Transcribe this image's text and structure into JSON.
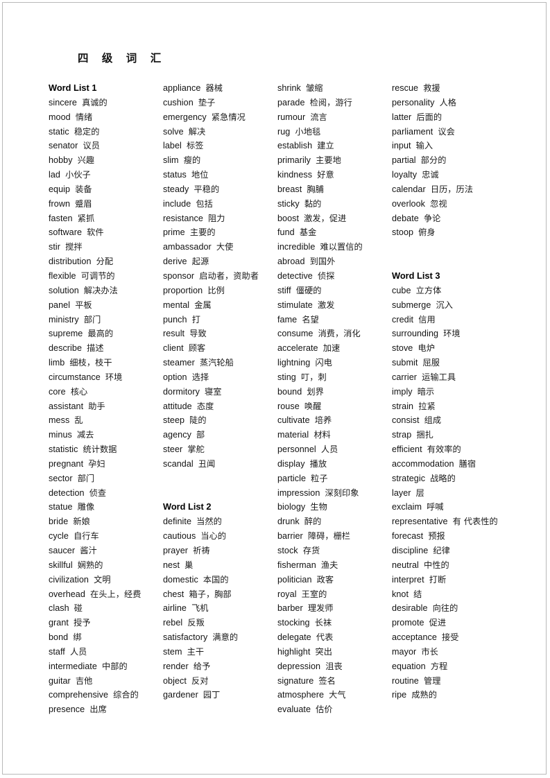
{
  "document": {
    "title": "四 级 词 汇",
    "page_border_color": "#b9b9b9"
  },
  "columns": [
    {
      "name": "column-1",
      "blocks": [
        {
          "type": "heading",
          "text": "Word List 1"
        },
        {
          "type": "entry",
          "term": "sincere",
          "gloss": "真诚的"
        },
        {
          "type": "entry",
          "term": "mood",
          "gloss": "情绪"
        },
        {
          "type": "entry",
          "term": "static",
          "gloss": "稳定的"
        },
        {
          "type": "entry",
          "term": "senator",
          "gloss": "议员"
        },
        {
          "type": "entry",
          "term": "hobby",
          "gloss": "兴趣"
        },
        {
          "type": "entry",
          "term": "lad",
          "gloss": "小伙子"
        },
        {
          "type": "entry",
          "term": "equip",
          "gloss": "装备"
        },
        {
          "type": "entry",
          "term": "frown",
          "gloss": "蹙眉"
        },
        {
          "type": "entry",
          "term": "fasten",
          "gloss": "紧抓"
        },
        {
          "type": "entry",
          "term": "software",
          "gloss": "软件"
        },
        {
          "type": "entry",
          "term": "stir",
          "gloss": "搅拌"
        },
        {
          "type": "entry",
          "term": "distribution",
          "gloss": "分配"
        },
        {
          "type": "entry",
          "term": "flexible",
          "gloss": "可调节的"
        },
        {
          "type": "entry",
          "term": "solution",
          "gloss": "解决办法"
        },
        {
          "type": "entry",
          "term": "panel",
          "gloss": "平板"
        },
        {
          "type": "entry",
          "term": "ministry",
          "gloss": "部门"
        },
        {
          "type": "entry",
          "term": "supreme",
          "gloss": "最高的"
        },
        {
          "type": "entry",
          "term": "describe",
          "gloss": "描述"
        },
        {
          "type": "entry",
          "term": "limb",
          "gloss": "细枝，枝干"
        },
        {
          "type": "entry",
          "term": "circumstance",
          "gloss": "环境"
        },
        {
          "type": "entry",
          "term": "core",
          "gloss": "核心"
        },
        {
          "type": "entry",
          "term": "assistant",
          "gloss": "助手"
        },
        {
          "type": "entry",
          "term": "mess",
          "gloss": "乱"
        },
        {
          "type": "entry",
          "term": "minus",
          "gloss": "减去"
        },
        {
          "type": "entry",
          "term": "statistic",
          "gloss": "统计数据"
        },
        {
          "type": "entry",
          "term": "pregnant",
          "gloss": "孕妇"
        },
        {
          "type": "entry",
          "term": "sector",
          "gloss": "部门"
        },
        {
          "type": "entry",
          "term": "detection",
          "gloss": "侦查"
        },
        {
          "type": "entry",
          "term": "statue",
          "gloss": "雕像"
        },
        {
          "type": "entry",
          "term": "bride",
          "gloss": "新娘"
        },
        {
          "type": "entry",
          "term": "cycle",
          "gloss": "自行车"
        },
        {
          "type": "entry",
          "term": "saucer",
          "gloss": "酱汁"
        },
        {
          "type": "entry",
          "term": "skillful",
          "gloss": "娴熟的"
        },
        {
          "type": "entry",
          "term": "civilization",
          "gloss": "文明"
        },
        {
          "type": "entry",
          "term": "overhead",
          "gloss": "在头上，经费"
        },
        {
          "type": "entry",
          "term": "clash",
          "gloss": "碰"
        },
        {
          "type": "entry",
          "term": "grant",
          "gloss": "授予"
        },
        {
          "type": "entry",
          "term": "bond",
          "gloss": "绑"
        },
        {
          "type": "entry",
          "term": "staff",
          "gloss": "人员"
        },
        {
          "type": "entry",
          "term": "intermediate",
          "gloss": "中部的"
        },
        {
          "type": "entry",
          "term": "guitar",
          "gloss": "吉他"
        },
        {
          "type": "entry",
          "term": "comprehensive",
          "gloss": "综合的"
        },
        {
          "type": "entry",
          "term": "presence",
          "gloss": "出席"
        }
      ]
    },
    {
      "name": "column-2",
      "blocks": [
        {
          "type": "entry",
          "term": "appliance",
          "gloss": "器械"
        },
        {
          "type": "entry",
          "term": "cushion",
          "gloss": "垫子"
        },
        {
          "type": "entry",
          "term": "emergency",
          "gloss": "紧急情况"
        },
        {
          "type": "entry",
          "term": "solve",
          "gloss": "解决"
        },
        {
          "type": "entry",
          "term": "label",
          "gloss": "标签"
        },
        {
          "type": "entry",
          "term": "slim",
          "gloss": "瘦的"
        },
        {
          "type": "entry",
          "term": "status",
          "gloss": "地位"
        },
        {
          "type": "entry",
          "term": "steady",
          "gloss": "平稳的"
        },
        {
          "type": "entry",
          "term": "include",
          "gloss": "包括"
        },
        {
          "type": "entry",
          "term": "resistance",
          "gloss": "阻力"
        },
        {
          "type": "entry",
          "term": "prime",
          "gloss": "主要的"
        },
        {
          "type": "entry",
          "term": "ambassador",
          "gloss": "大使"
        },
        {
          "type": "entry",
          "term": "derive",
          "gloss": "起源"
        },
        {
          "type": "entry",
          "term": "sponsor",
          "gloss": "启动者，资助者"
        },
        {
          "type": "entry",
          "term": "proportion",
          "gloss": "比例"
        },
        {
          "type": "entry",
          "term": "mental",
          "gloss": "金属"
        },
        {
          "type": "entry",
          "term": "punch",
          "gloss": "打"
        },
        {
          "type": "entry",
          "term": "result",
          "gloss": "导致"
        },
        {
          "type": "entry",
          "term": "client",
          "gloss": "顾客"
        },
        {
          "type": "entry",
          "term": "steamer",
          "gloss": "蒸汽轮船"
        },
        {
          "type": "entry",
          "term": "option",
          "gloss": "选择"
        },
        {
          "type": "entry",
          "term": "dormitory",
          "gloss": "寝室"
        },
        {
          "type": "entry",
          "term": "attitude",
          "gloss": "态度"
        },
        {
          "type": "entry",
          "term": "steep",
          "gloss": "陡的"
        },
        {
          "type": "entry",
          "term": "agency",
          "gloss": "部"
        },
        {
          "type": "entry",
          "term": "steer",
          "gloss": "掌舵"
        },
        {
          "type": "entry",
          "term": "scandal",
          "gloss": "丑闻"
        },
        {
          "type": "spacer"
        },
        {
          "type": "spacer"
        },
        {
          "type": "heading",
          "text": "Word List 2"
        },
        {
          "type": "entry",
          "term": "definite",
          "gloss": "当然的"
        },
        {
          "type": "entry",
          "term": "cautious",
          "gloss": "当心的"
        },
        {
          "type": "entry",
          "term": "prayer",
          "gloss": "祈祷"
        },
        {
          "type": "entry",
          "term": "nest",
          "gloss": "巢"
        },
        {
          "type": "entry",
          "term": "domestic",
          "gloss": "本国的"
        },
        {
          "type": "entry",
          "term": "chest",
          "gloss": "箱子，胸部"
        },
        {
          "type": "entry",
          "term": "airline",
          "gloss": "飞机"
        },
        {
          "type": "entry",
          "term": "rebel",
          "gloss": "反叛"
        },
        {
          "type": "entry",
          "term": "satisfactory",
          "gloss": "满意的"
        },
        {
          "type": "entry",
          "term": "stem",
          "gloss": "主干"
        },
        {
          "type": "entry",
          "term": "render",
          "gloss": "给予"
        },
        {
          "type": "entry",
          "term": "object",
          "gloss": "反对"
        },
        {
          "type": "entry",
          "term": "gardener",
          "gloss": "园丁"
        }
      ]
    },
    {
      "name": "column-3",
      "blocks": [
        {
          "type": "entry",
          "term": "shrink",
          "gloss": "皱缩"
        },
        {
          "type": "entry",
          "term": "parade",
          "gloss": "检阅，游行"
        },
        {
          "type": "entry",
          "term": "rumour",
          "gloss": "流言"
        },
        {
          "type": "entry",
          "term": "rug",
          "gloss": "小地毯"
        },
        {
          "type": "entry",
          "term": "establish",
          "gloss": "建立"
        },
        {
          "type": "entry",
          "term": "primarily",
          "gloss": "主要地"
        },
        {
          "type": "entry",
          "term": "kindness",
          "gloss": "好意"
        },
        {
          "type": "entry",
          "term": "breast",
          "gloss": "胸脯"
        },
        {
          "type": "entry",
          "term": "sticky",
          "gloss": "黏的"
        },
        {
          "type": "entry",
          "term": "boost",
          "gloss": "激发，促进"
        },
        {
          "type": "entry",
          "term": "fund",
          "gloss": "基金"
        },
        {
          "type": "entry",
          "term": "incredible",
          "gloss": "难以置信的"
        },
        {
          "type": "entry",
          "term": "abroad",
          "gloss": "到国外"
        },
        {
          "type": "entry",
          "term": "detective",
          "gloss": "侦探"
        },
        {
          "type": "entry",
          "term": "stiff",
          "gloss": "僵硬的"
        },
        {
          "type": "entry",
          "term": "stimulate",
          "gloss": "激发"
        },
        {
          "type": "entry",
          "term": "fame",
          "gloss": "名望"
        },
        {
          "type": "entry",
          "term": "consume",
          "gloss": "消费，消化"
        },
        {
          "type": "entry",
          "term": "accelerate",
          "gloss": "加速"
        },
        {
          "type": "entry",
          "term": "lightning",
          "gloss": "闪电"
        },
        {
          "type": "entry",
          "term": "sting",
          "gloss": "叮，刺"
        },
        {
          "type": "entry",
          "term": "bound",
          "gloss": "划界"
        },
        {
          "type": "entry",
          "term": "rouse",
          "gloss": "唤醒"
        },
        {
          "type": "entry",
          "term": "cultivate",
          "gloss": "培养"
        },
        {
          "type": "entry",
          "term": "material",
          "gloss": "材料"
        },
        {
          "type": "entry",
          "term": "personnel",
          "gloss": "人员"
        },
        {
          "type": "entry",
          "term": "display",
          "gloss": "播放"
        },
        {
          "type": "entry",
          "term": "particle",
          "gloss": "粒子"
        },
        {
          "type": "entry",
          "term": "impression",
          "gloss": "深刻印象"
        },
        {
          "type": "entry",
          "term": "biology",
          "gloss": "生物"
        },
        {
          "type": "entry",
          "term": "drunk",
          "gloss": "醉的"
        },
        {
          "type": "entry",
          "term": "barrier",
          "gloss": "障碍，栅栏"
        },
        {
          "type": "entry",
          "term": "stock",
          "gloss": "存货"
        },
        {
          "type": "entry",
          "term": "fisherman",
          "gloss": "渔夫"
        },
        {
          "type": "entry",
          "term": "politician",
          "gloss": "政客"
        },
        {
          "type": "entry",
          "term": "royal",
          "gloss": "王室的"
        },
        {
          "type": "entry",
          "term": "barber",
          "gloss": "理发师"
        },
        {
          "type": "entry",
          "term": "stocking",
          "gloss": "长袜"
        },
        {
          "type": "entry",
          "term": "delegate",
          "gloss": "代表"
        },
        {
          "type": "entry",
          "term": "highlight",
          "gloss": "突出"
        },
        {
          "type": "entry",
          "term": "depression",
          "gloss": "沮丧"
        },
        {
          "type": "entry",
          "term": "signature",
          "gloss": "签名"
        },
        {
          "type": "entry",
          "term": "atmosphere",
          "gloss": "大气"
        },
        {
          "type": "entry",
          "term": "evaluate",
          "gloss": "估价"
        }
      ]
    },
    {
      "name": "column-4",
      "blocks": [
        {
          "type": "entry",
          "term": "rescue",
          "gloss": "救援"
        },
        {
          "type": "entry",
          "term": "personality",
          "gloss": "人格"
        },
        {
          "type": "entry",
          "term": "latter",
          "gloss": "后面的"
        },
        {
          "type": "entry",
          "term": "parliament",
          "gloss": "议会"
        },
        {
          "type": "entry",
          "term": "input",
          "gloss": "输入"
        },
        {
          "type": "entry",
          "term": "partial",
          "gloss": "部分的"
        },
        {
          "type": "entry",
          "term": "loyalty",
          "gloss": "忠诚"
        },
        {
          "type": "entry",
          "term": "calendar",
          "gloss": "日历，历法"
        },
        {
          "type": "entry",
          "term": "overlook",
          "gloss": "忽视"
        },
        {
          "type": "entry",
          "term": "debate",
          "gloss": "争论"
        },
        {
          "type": "entry",
          "term": "stoop",
          "gloss": "俯身"
        },
        {
          "type": "spacer"
        },
        {
          "type": "spacer"
        },
        {
          "type": "heading",
          "text": "Word List 3"
        },
        {
          "type": "entry",
          "term": "cube",
          "gloss": "立方体"
        },
        {
          "type": "entry",
          "term": "submerge",
          "gloss": "沉入"
        },
        {
          "type": "entry",
          "term": "credit",
          "gloss": "信用"
        },
        {
          "type": "entry",
          "term": "surrounding",
          "gloss": "环境"
        },
        {
          "type": "entry",
          "term": "stove",
          "gloss": "电炉"
        },
        {
          "type": "entry",
          "term": "submit",
          "gloss": "屈服"
        },
        {
          "type": "entry",
          "term": "carrier",
          "gloss": "运输工具"
        },
        {
          "type": "entry",
          "term": "imply",
          "gloss": "暗示"
        },
        {
          "type": "entry",
          "term": "strain",
          "gloss": "拉紧"
        },
        {
          "type": "entry",
          "term": "consist",
          "gloss": "组成"
        },
        {
          "type": "entry",
          "term": "strap",
          "gloss": "捆扎"
        },
        {
          "type": "entry",
          "term": "efficient",
          "gloss": "有效率的"
        },
        {
          "type": "entry",
          "term": "accommodation",
          "gloss": "膳宿"
        },
        {
          "type": "entry",
          "term": "strategic",
          "gloss": "战略的"
        },
        {
          "type": "entry",
          "term": "layer",
          "gloss": "层"
        },
        {
          "type": "entry",
          "term": "exclaim",
          "gloss": "呼喊"
        },
        {
          "type": "entry",
          "term": "representative",
          "gloss": "有 代表性的"
        },
        {
          "type": "entry",
          "term": "forecast",
          "gloss": "预报"
        },
        {
          "type": "entry",
          "term": "discipline",
          "gloss": "纪律"
        },
        {
          "type": "entry",
          "term": "neutral",
          "gloss": "中性的"
        },
        {
          "type": "entry",
          "term": "interpret",
          "gloss": "打断"
        },
        {
          "type": "entry",
          "term": "knot",
          "gloss": "结"
        },
        {
          "type": "entry",
          "term": "desirable",
          "gloss": "向往的"
        },
        {
          "type": "entry",
          "term": "promote",
          "gloss": "促进"
        },
        {
          "type": "entry",
          "term": "acceptance",
          "gloss": "接受"
        },
        {
          "type": "entry",
          "term": "mayor",
          "gloss": "市长"
        },
        {
          "type": "entry",
          "term": "equation",
          "gloss": "方程"
        },
        {
          "type": "entry",
          "term": "routine",
          "gloss": "管理"
        },
        {
          "type": "entry",
          "term": "ripe",
          "gloss": "成熟的"
        }
      ]
    }
  ]
}
